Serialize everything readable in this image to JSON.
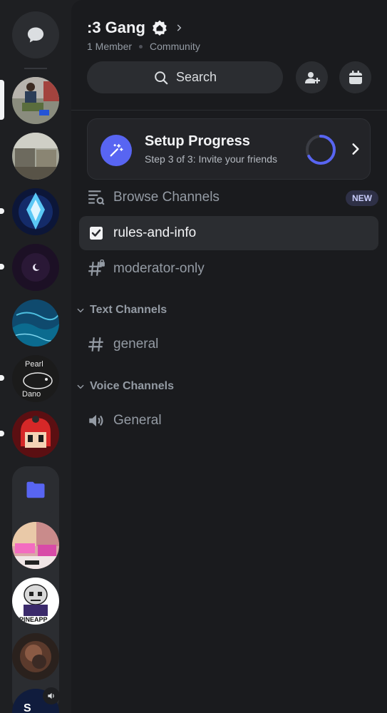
{
  "server": {
    "name": ":3 Gang",
    "member_count": "1 Member",
    "type": "Community"
  },
  "search": {
    "label": "Search"
  },
  "setup": {
    "title": "Setup Progress",
    "subtitle": "Step 3 of 3: Invite your friends",
    "progress": 0.67
  },
  "channels": {
    "browse": {
      "label": "Browse Channels",
      "badge": "NEW"
    },
    "rules": {
      "label": "rules-and-info"
    },
    "moderator": {
      "label": "moderator-only"
    }
  },
  "categories": {
    "text": {
      "label": "Text Channels",
      "channels": [
        {
          "label": "general"
        }
      ]
    },
    "voice": {
      "label": "Voice Channels",
      "channels": [
        {
          "label": "General"
        }
      ]
    }
  },
  "colors": {
    "accent": "#5865f2",
    "background": "#1a1b1e",
    "rail": "#1e1f22"
  },
  "rail_icons": [
    "direct-messages-icon",
    "server-icon-photo",
    "server-icon-room",
    "server-icon-crystal",
    "server-icon-moon",
    "server-icon-ocean",
    "server-icon-pearl-fish",
    "server-icon-megaman",
    "folder-icon",
    "server-icon-art",
    "server-icon-pineapple",
    "server-icon-dark",
    "server-icon-voice"
  ]
}
